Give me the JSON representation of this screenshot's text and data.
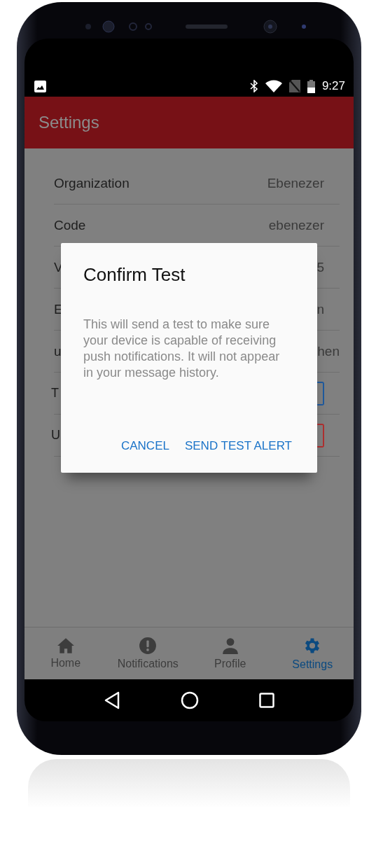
{
  "status_bar": {
    "time": "9:27"
  },
  "app_bar": {
    "title": "Settings"
  },
  "settings_rows": [
    {
      "kind": "text",
      "label": "Organization",
      "value": "Ebenezer"
    },
    {
      "kind": "text",
      "label": "Code",
      "value": "ebenezer"
    },
    {
      "kind": "text",
      "label": "V",
      "value": "5"
    },
    {
      "kind": "text",
      "label": "E",
      "value": "n"
    },
    {
      "kind": "clipped",
      "label": "u",
      "value": "hen"
    },
    {
      "kind": "button",
      "label": "T",
      "color": "#1f5a9e"
    },
    {
      "kind": "button",
      "label": "U",
      "color": "#b03030"
    }
  ],
  "dialog": {
    "title": "Confirm Test",
    "message": "This will send a test to make sure your device is capable of receiving push notifications. It will not appear in your message history.",
    "actions": [
      "CANCEL",
      "SEND TEST ALERT"
    ]
  },
  "tabs": [
    {
      "label": "Home",
      "selected": false
    },
    {
      "label": "Notifications",
      "selected": false
    },
    {
      "label": "Profile",
      "selected": false
    },
    {
      "label": "Settings",
      "selected": true
    }
  ]
}
